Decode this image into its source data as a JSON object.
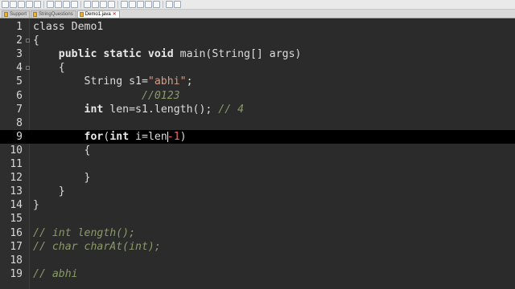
{
  "tabs": [
    {
      "label": "Support",
      "active": false
    },
    {
      "label": "StringQuestions",
      "active": false
    },
    {
      "label": "Demo1.java",
      "active": true
    }
  ],
  "editor": {
    "lines": [
      {
        "no": "1",
        "tokens": [
          {
            "t": "class Demo1",
            "c": ""
          }
        ]
      },
      {
        "no": "2",
        "tokens": [
          {
            "t": "{",
            "c": ""
          }
        ]
      },
      {
        "no": "3",
        "tokens": [
          {
            "t": "    ",
            "c": ""
          },
          {
            "t": "public static void",
            "c": "kw"
          },
          {
            "t": " main(String[] args)",
            "c": ""
          }
        ]
      },
      {
        "no": "4",
        "tokens": [
          {
            "t": "    {",
            "c": ""
          }
        ]
      },
      {
        "no": "5",
        "tokens": [
          {
            "t": "        String s1=",
            "c": ""
          },
          {
            "t": "\"abhi\"",
            "c": "str"
          },
          {
            "t": ";",
            "c": ""
          }
        ]
      },
      {
        "no": "6",
        "tokens": [
          {
            "t": "                 //0123",
            "c": "cm"
          }
        ]
      },
      {
        "no": "7",
        "tokens": [
          {
            "t": "        ",
            "c": ""
          },
          {
            "t": "int",
            "c": "kw"
          },
          {
            "t": " len=s1.length(); ",
            "c": ""
          },
          {
            "t": "// 4",
            "c": "cm"
          }
        ]
      },
      {
        "no": "8",
        "tokens": [
          {
            "t": "",
            "c": ""
          }
        ]
      },
      {
        "no": "9",
        "tokens": [
          {
            "t": "        ",
            "c": ""
          },
          {
            "t": "for",
            "c": "kw"
          },
          {
            "t": "(",
            "c": ""
          },
          {
            "t": "int",
            "c": "kw"
          },
          {
            "t": " i=len",
            "c": ""
          },
          {
            "t": "-1",
            "c": "num"
          },
          {
            "t": ")",
            "c": ""
          }
        ]
      },
      {
        "no": "10",
        "tokens": [
          {
            "t": "        {",
            "c": ""
          }
        ]
      },
      {
        "no": "11",
        "tokens": [
          {
            "t": "",
            "c": ""
          }
        ]
      },
      {
        "no": "12",
        "tokens": [
          {
            "t": "        }",
            "c": ""
          }
        ]
      },
      {
        "no": "13",
        "tokens": [
          {
            "t": "    }",
            "c": ""
          }
        ]
      },
      {
        "no": "14",
        "tokens": [
          {
            "t": "}",
            "c": ""
          }
        ]
      },
      {
        "no": "15",
        "tokens": [
          {
            "t": "",
            "c": ""
          }
        ]
      },
      {
        "no": "16",
        "tokens": [
          {
            "t": "// int length();",
            "c": "cm"
          }
        ]
      },
      {
        "no": "17",
        "tokens": [
          {
            "t": "// char charAt(int);",
            "c": "cm"
          }
        ]
      },
      {
        "no": "18",
        "tokens": [
          {
            "t": "",
            "c": ""
          }
        ]
      },
      {
        "no": "19",
        "tokens": [
          {
            "t": "// abhi",
            "c": "cm"
          }
        ]
      }
    ],
    "current_line": 9,
    "colors": {
      "background": "#2b2b2b",
      "current_line": "#000000",
      "comment": "#8a9a6a",
      "string": "#d69d85",
      "number": "#e86a6a"
    }
  },
  "toolbar": {
    "icons": [
      "new-icon",
      "open-icon",
      "save-icon",
      "save-all-icon",
      "close-icon",
      "print-icon",
      "cut-icon",
      "copy-icon",
      "paste-icon",
      "undo-icon",
      "redo-icon",
      "find-icon",
      "replace-icon",
      "zoom-in-icon",
      "zoom-out-icon",
      "sync-icon",
      "wrap-icon",
      "indent-guide-icon",
      "record-macro-icon",
      "play-macro-icon"
    ]
  }
}
